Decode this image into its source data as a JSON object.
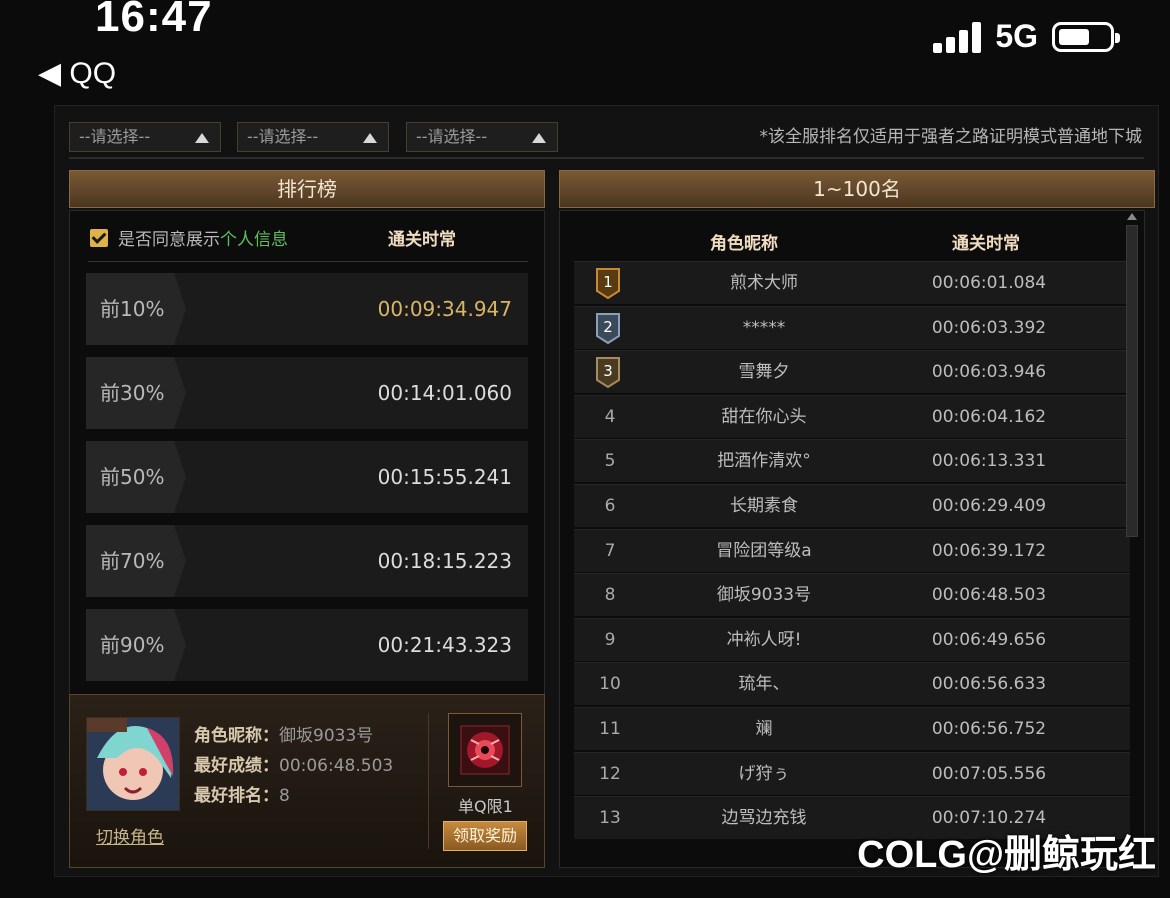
{
  "status_bar": {
    "time": "16:47",
    "back_label": "◀ QQ",
    "network": "5G",
    "battery_level": 0.6
  },
  "filters": {
    "dropdowns": [
      {
        "value": "--请选择--"
      },
      {
        "value": "--请选择--"
      },
      {
        "value": "--请选择--"
      }
    ],
    "notice": "*该全服排名仅适用于强者之路证明模式普通地下城"
  },
  "left_panel": {
    "title": "排行榜",
    "agree_text": "是否同意展示",
    "agree_link": "个人信息",
    "agree_checked": true,
    "time_header": "通关时常",
    "percentiles": [
      {
        "label": "前10%",
        "time": "00:09:34.947",
        "highlight": true
      },
      {
        "label": "前30%",
        "time": "00:14:01.060",
        "highlight": false
      },
      {
        "label": "前50%",
        "time": "00:15:55.241",
        "highlight": false
      },
      {
        "label": "前70%",
        "time": "00:18:15.223",
        "highlight": false
      },
      {
        "label": "前90%",
        "time": "00:21:43.323",
        "highlight": false
      }
    ]
  },
  "character": {
    "name_label": "角色昵称：",
    "name": "御坂9033号",
    "best_score_label": "最好成绩：",
    "best_score": "00:06:48.503",
    "best_rank_label": "最好排名：",
    "best_rank": "8",
    "switch_label": "切换角色",
    "item_label": "单Q限1",
    "claim_label": "领取奖励"
  },
  "right_panel": {
    "title": "1~100名",
    "col_name": "角色昵称",
    "col_time": "通关时常",
    "rows": [
      {
        "rank": "1",
        "name": "煎术大师",
        "time": "00:06:01.084",
        "medal": "gold"
      },
      {
        "rank": "2",
        "name": "*****",
        "time": "00:06:03.392",
        "medal": "silver"
      },
      {
        "rank": "3",
        "name": "雪舞夕",
        "time": "00:06:03.946",
        "medal": "bronze"
      },
      {
        "rank": "4",
        "name": "甜在你心头",
        "time": "00:06:04.162",
        "medal": ""
      },
      {
        "rank": "5",
        "name": "把酒作清欢°",
        "time": "00:06:13.331",
        "medal": ""
      },
      {
        "rank": "6",
        "name": "长期素食",
        "time": "00:06:29.409",
        "medal": ""
      },
      {
        "rank": "7",
        "name": "冒险团等级a",
        "time": "00:06:39.172",
        "medal": ""
      },
      {
        "rank": "8",
        "name": "御坂9033号",
        "time": "00:06:48.503",
        "medal": ""
      },
      {
        "rank": "9",
        "name": "冲袮人呀!",
        "time": "00:06:49.656",
        "medal": ""
      },
      {
        "rank": "10",
        "name": "琉年、",
        "time": "00:06:56.633",
        "medal": ""
      },
      {
        "rank": "11",
        "name": "斓",
        "time": "00:06:56.752",
        "medal": ""
      },
      {
        "rank": "12",
        "name": "げ狩ぅ",
        "time": "00:07:05.556",
        "medal": ""
      },
      {
        "rank": "13",
        "name": "边骂边充钱",
        "time": "00:07:10.274",
        "medal": ""
      }
    ]
  },
  "watermark": "COLG@删鲸玩红",
  "colors": {
    "accent_gold": "#e0b24a",
    "highlight_text": "#d9b56a",
    "link_green": "#5fbf5f"
  }
}
